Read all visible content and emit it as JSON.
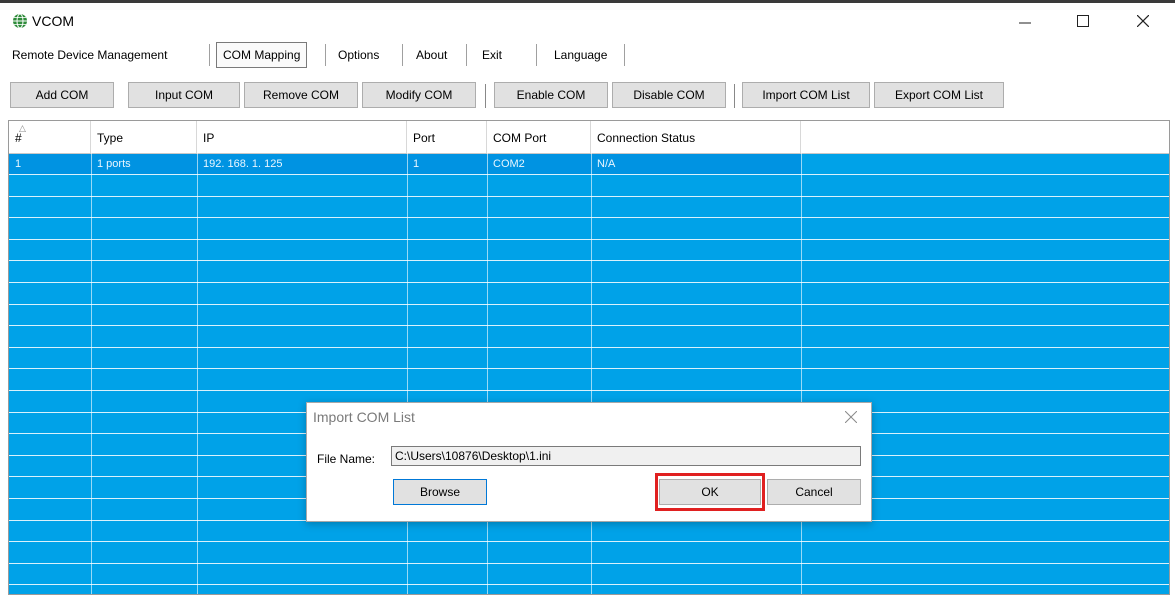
{
  "window": {
    "title": "VCOM",
    "icon": "globe-network-icon"
  },
  "menu": {
    "items": [
      "Remote Device Management",
      "COM Mapping",
      "Options",
      "About",
      "Exit",
      "Language"
    ],
    "active": "COM Mapping"
  },
  "toolbar": {
    "buttons": [
      "Add COM",
      "Input COM",
      "Remove COM",
      "Modify COM",
      "Enable COM",
      "Disable COM",
      "Import COM List",
      "Export COM List"
    ]
  },
  "table": {
    "columns": [
      "#",
      "Type",
      "IP",
      "Port",
      "COM Port",
      "Connection Status"
    ],
    "rows": [
      [
        "1",
        "1 ports",
        "192. 168. 1. 125",
        "1",
        "COM2",
        "N/A"
      ]
    ]
  },
  "dialog": {
    "title": "Import COM List",
    "file_label": "File Name:",
    "file_value": "C:\\Users\\10876\\Desktop\\1.ini",
    "browse_label": "Browse",
    "ok_label": "OK",
    "cancel_label": "Cancel"
  },
  "colors": {
    "grid_bg": "#00a2e8",
    "highlight": "#e02020",
    "focus": "#0078d7"
  }
}
